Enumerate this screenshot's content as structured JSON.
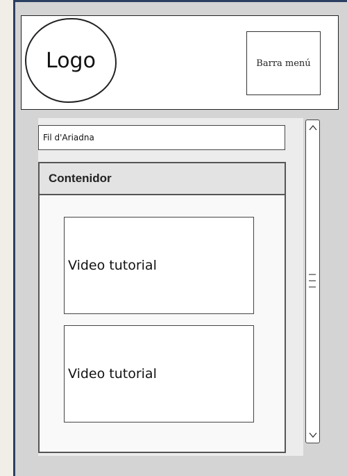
{
  "header": {
    "logo_label": "Logo",
    "menu_label": "Barra menú"
  },
  "breadcrumb": {
    "label": "Fil d'Ariadna"
  },
  "container": {
    "title": "Contenidor",
    "items": [
      {
        "label": "Video tutorial"
      },
      {
        "label": "Video tutorial"
      }
    ]
  },
  "scrollbar": {
    "up_icon": "chevron-up-icon",
    "down_icon": "chevron-down-icon",
    "grip_icon": "grip-icon"
  }
}
